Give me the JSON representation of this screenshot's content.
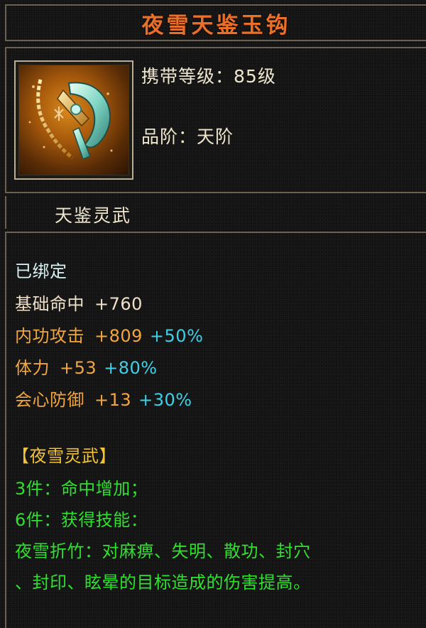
{
  "item": {
    "name": "夜雪天鉴玉钩",
    "icon": "jade-hook-weapon-icon",
    "level_label": "携带等级：",
    "level_value": "85级",
    "grade_label": "品阶：",
    "grade_value": "天阶",
    "category": "天鉴灵武",
    "bound": "已绑定"
  },
  "stats": [
    {
      "name": "基础命中",
      "value": "+760",
      "bonus": ""
    },
    {
      "name": "内功攻击",
      "value": "+809",
      "bonus": "+50%"
    },
    {
      "name": "体力",
      "value": "+53",
      "bonus": "+80%"
    },
    {
      "name": "会心防御",
      "value": "+13",
      "bonus": "+30%"
    }
  ],
  "set": {
    "name": "【夜雪灵武】",
    "bonus_3": "3件：命中增加；",
    "bonus_6": "6件：获得技能：",
    "skill_line_1": "夜雪折竹：对麻痹、失明、散功、封穴",
    "skill_line_2": "、封印、眩晕的目标造成的伤害提高。"
  },
  "colors": {
    "title": "#e8702a",
    "stat_orange": "#f2a640",
    "bonus_cyan": "#3fd0e8",
    "set_green": "#2fe02f",
    "frame": "#6b6150"
  }
}
